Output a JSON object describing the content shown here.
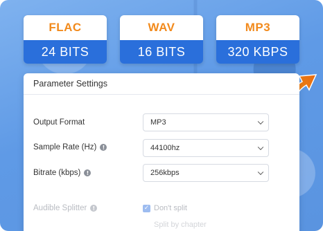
{
  "badges": [
    {
      "format": "FLAC",
      "value": "24 BITS"
    },
    {
      "format": "WAV",
      "value": "16 BITS"
    },
    {
      "format": "MP3",
      "value": "320 KBPS"
    }
  ],
  "panel": {
    "title": "Parameter Settings",
    "output_format": {
      "label": "Output Format",
      "value": "MP3"
    },
    "sample_rate": {
      "label": "Sample Rate (Hz)",
      "value": "44100hz"
    },
    "bitrate": {
      "label": "Bitrate (kbps)",
      "value": "256kbps"
    },
    "audible_splitter": {
      "label": "Audible Splitter",
      "option_checked": "Don't split",
      "option_next": "Split by chapter"
    }
  },
  "colors": {
    "accent_orange": "#f28a1c",
    "accent_blue": "#2a6fdb"
  },
  "icons": {
    "info": "info-icon",
    "arrow": "curved-arrow-icon",
    "chevron": "chevron-down-icon",
    "check": "checkbox-checked-icon"
  }
}
